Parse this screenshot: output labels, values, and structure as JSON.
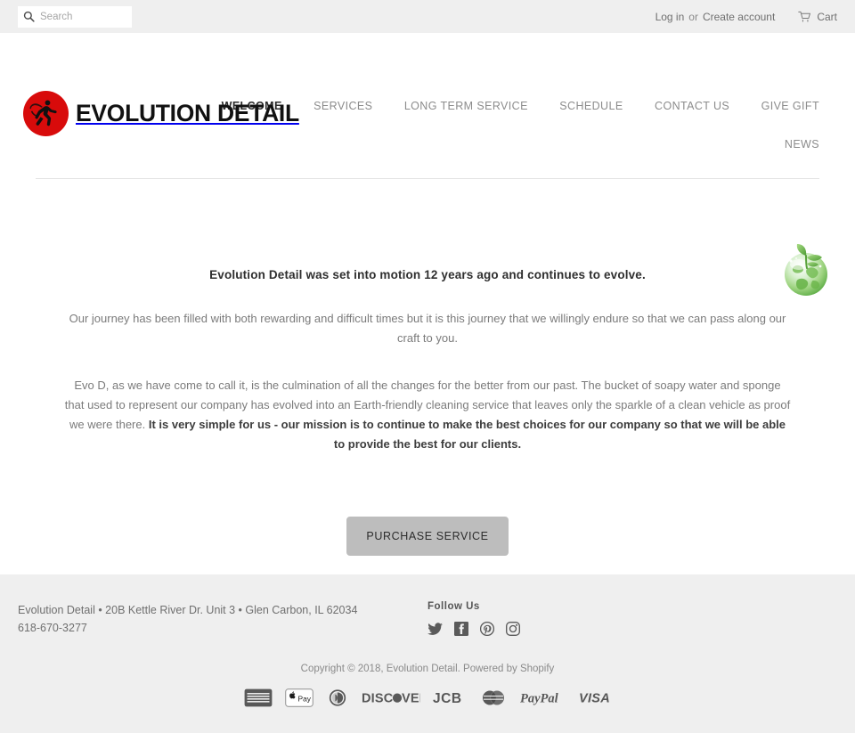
{
  "topbar": {
    "search": {
      "placeholder": "Search",
      "value": "",
      "icon": "search-icon"
    },
    "login_label": "Log in",
    "or_label": "or",
    "create_account_label": "Create account",
    "cart_label": "Cart",
    "cart_icon": "shopping-cart-icon",
    "background": "#efefef"
  },
  "header": {
    "logo_icon": "running-figure-logo-icon",
    "brand_name": "EVOLUTION DETAIL",
    "brand_mark_color": "#d80b0b",
    "nav_row1": [
      {
        "label": "WELCOME",
        "active": true
      },
      {
        "label": "SERVICES",
        "active": false
      },
      {
        "label": "LONG TERM SERVICE",
        "active": false
      },
      {
        "label": "SCHEDULE",
        "active": false
      },
      {
        "label": "CONTACT US",
        "active": false
      },
      {
        "label": "GIVE GIFT",
        "active": false
      }
    ],
    "nav_row2": [
      {
        "label": "NEWS",
        "active": false
      }
    ]
  },
  "main": {
    "decor_icon": "green-earth-plant-icon",
    "lead": "Evolution Detail was set into motion 12 years ago and continues to evolve.",
    "paragraph_1": "Our journey has been filled with both rewarding and difficult times but it is this journey that we willingly endure so that we can pass along our craft to you.",
    "paragraph_2_normal_a": "Evo D, as we have come to call it, is the culmination of all the changes for the better from our past. The bucket of soapy water and sponge that used to represent our company has evolved into an Earth-friendly cleaning service that leaves only the sparkle of a clean vehicle as proof we were there. ",
    "paragraph_2_bold": "It is very simple for us - our mission is to continue to make the best choices for our company so that we will be able to provide the best for our clients.",
    "cta_label": "PURCHASE SERVICE",
    "cta_color": "#bdbdbd"
  },
  "footer": {
    "address_line1": "Evolution Detail • 20B Kettle River Dr. Unit 3 • Glen Carbon, IL 62034",
    "address_line2": "618-670-3277",
    "follow_title": "Follow Us",
    "social": [
      {
        "name": "twitter-icon",
        "label": "Twitter"
      },
      {
        "name": "facebook-icon",
        "label": "Facebook"
      },
      {
        "name": "pinterest-icon",
        "label": "Pinterest"
      },
      {
        "name": "instagram-icon",
        "label": "Instagram"
      }
    ],
    "copyright": "Copyright © 2018, Evolution Detail. Powered by Shopify",
    "payments": [
      {
        "name": "american-express-icon",
        "label": "American Express"
      },
      {
        "name": "apple-pay-icon",
        "label": "Apple Pay"
      },
      {
        "name": "diners-club-icon",
        "label": "Diners Club"
      },
      {
        "name": "discover-icon",
        "label": "DISCOVER"
      },
      {
        "name": "jcb-icon",
        "label": "JCB"
      },
      {
        "name": "mastercard-icon",
        "label": "Mastercard"
      },
      {
        "name": "paypal-icon",
        "label": "PayPal"
      },
      {
        "name": "visa-icon",
        "label": "VISA"
      }
    ],
    "background": "#efefef"
  }
}
